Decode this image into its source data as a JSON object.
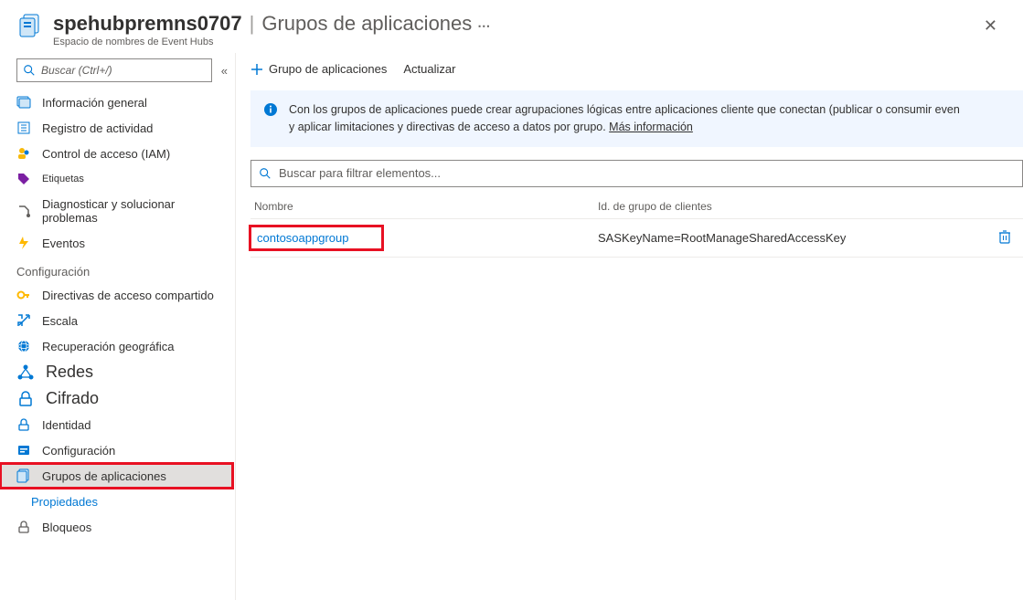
{
  "header": {
    "titleMain": "spehubpremns0707",
    "titleSub": "Grupos de aplicaciones",
    "subtitle": "Espacio de nombres de Event Hubs"
  },
  "sidebar": {
    "searchPlaceholder": "Buscar (Ctrl+/)",
    "items": [
      {
        "label": "Información general"
      },
      {
        "label": "Registro de actividad"
      },
      {
        "label": "Control de acceso (IAM)"
      },
      {
        "label": "Etiquetas"
      },
      {
        "label": "Diagnosticar y solucionar problemas"
      },
      {
        "label": "Eventos"
      }
    ],
    "configSection": "Configuración",
    "configItems": [
      {
        "label": "Directivas de acceso compartido"
      },
      {
        "label": "Escala"
      },
      {
        "label": "Recuperación geográfica"
      },
      {
        "label": "Redes"
      },
      {
        "label": "Cifrado"
      },
      {
        "label": "Identidad"
      },
      {
        "label": "Configuración"
      },
      {
        "label": "Grupos de aplicaciones"
      },
      {
        "label": "Propiedades"
      },
      {
        "label": "Bloqueos"
      }
    ]
  },
  "toolbar": {
    "add": "Grupo de aplicaciones",
    "refresh": "Actualizar"
  },
  "info": {
    "text1": "Con los grupos de aplicaciones puede crear agrupaciones lógicas entre aplicaciones cliente que conectan (publicar o consumir even",
    "text2": "y aplicar limitaciones y directivas de acceso a datos por grupo. ",
    "moreLink": "Más información"
  },
  "filter": {
    "placeholder": "Buscar para filtrar elementos..."
  },
  "table": {
    "colName": "Nombre",
    "colId": "Id. de grupo de clientes",
    "rows": [
      {
        "name": "contosoappgroup",
        "clientId": "SASKeyName=RootManageSharedAccessKey"
      }
    ]
  }
}
